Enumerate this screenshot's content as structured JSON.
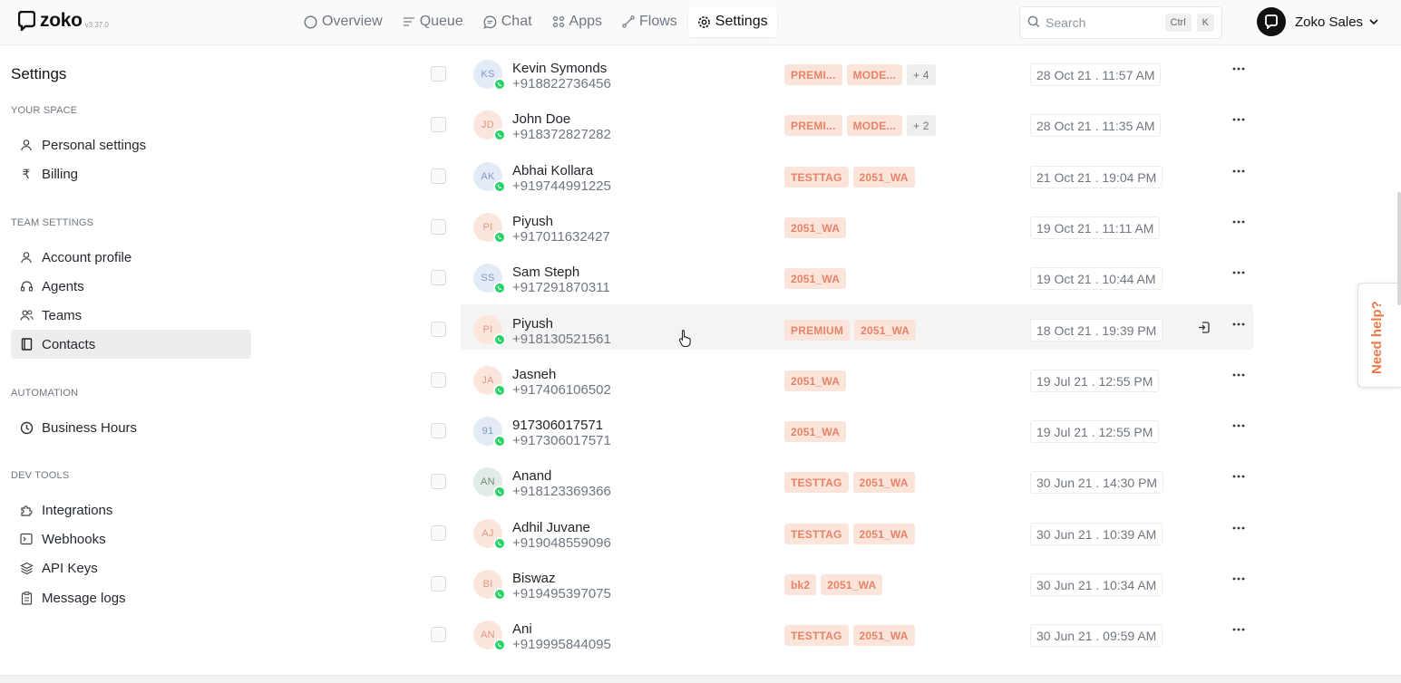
{
  "app": {
    "logo_text": "zoko",
    "version": "v3.37.0"
  },
  "nav": [
    {
      "label": "Overview",
      "icon": "circle-icon",
      "active": false
    },
    {
      "label": "Queue",
      "icon": "list-icon",
      "active": false
    },
    {
      "label": "Chat",
      "icon": "chat-icon",
      "active": false
    },
    {
      "label": "Apps",
      "icon": "grid-icon",
      "active": false
    },
    {
      "label": "Flows",
      "icon": "flow-icon",
      "active": false
    },
    {
      "label": "Settings",
      "icon": "gear-icon",
      "active": true
    }
  ],
  "search": {
    "placeholder": "Search",
    "shortcut_1": "Ctrl",
    "shortcut_2": "K"
  },
  "account": {
    "name": "Zoko Sales"
  },
  "sidebar": {
    "title": "Settings",
    "sections": {
      "your_space": "YOUR SPACE",
      "team_settings": "TEAM SETTINGS",
      "automation": "AUTOMATION",
      "dev_tools": "DEV TOOLS"
    },
    "items": {
      "personal": "Personal settings",
      "billing": "Billing",
      "account_profile": "Account profile",
      "agents": "Agents",
      "teams": "Teams",
      "contacts": "Contacts",
      "business_hours": "Business Hours",
      "integrations": "Integrations",
      "webhooks": "Webhooks",
      "api_keys": "API Keys",
      "message_logs": "Message logs"
    }
  },
  "contacts": [
    {
      "initials": "KS",
      "name": "Kevin Symonds",
      "phone": "+918822736456",
      "tags": [
        "PREMI...",
        "MODE...",
        "+ 4"
      ],
      "date": "28 Oct 21 . 11:57 AM",
      "avatar_color": "blue"
    },
    {
      "initials": "JD",
      "name": "John Doe",
      "phone": "+918372827282",
      "tags": [
        "PREMI...",
        "MODE...",
        "+ 2"
      ],
      "date": "28 Oct 21 . 11:35 AM",
      "avatar_color": "peach"
    },
    {
      "initials": "AK",
      "name": "Abhai Kollara",
      "phone": "+919744991225",
      "tags": [
        "TESTTAG",
        "2051_WA"
      ],
      "date": "21 Oct 21 . 19:04 PM",
      "avatar_color": "blue"
    },
    {
      "initials": "PI",
      "name": "Piyush",
      "phone": "+917011632427",
      "tags": [
        "2051_WA"
      ],
      "date": "19 Oct 21 . 11:11 AM",
      "avatar_color": "peach"
    },
    {
      "initials": "SS",
      "name": "Sam Steph",
      "phone": "+917291870311",
      "tags": [
        "2051_WA"
      ],
      "date": "19 Oct 21 . 10:44 AM",
      "avatar_color": "blue"
    },
    {
      "initials": "PI",
      "name": "Piyush",
      "phone": "+918130521561",
      "tags": [
        "PREMIUM",
        "2051_WA"
      ],
      "date": "18 Oct 21 . 19:39 PM",
      "avatar_color": "peach"
    },
    {
      "initials": "JA",
      "name": "Jasneh",
      "phone": "+917406106502",
      "tags": [
        "2051_WA"
      ],
      "date": "19 Jul 21 . 12:55 PM",
      "avatar_color": "peach"
    },
    {
      "initials": "91",
      "name": "917306017571",
      "phone": "+917306017571",
      "tags": [
        "2051_WA"
      ],
      "date": "19 Jul 21 . 12:55 PM",
      "avatar_color": "blue"
    },
    {
      "initials": "AN",
      "name": "Anand",
      "phone": "+918123369366",
      "tags": [
        "TESTTAG",
        "2051_WA"
      ],
      "date": "30 Jun 21 . 14:30 PM",
      "avatar_color": "green"
    },
    {
      "initials": "AJ",
      "name": "Adhil Juvane",
      "phone": "+919048559096",
      "tags": [
        "TESTTAG",
        "2051_WA"
      ],
      "date": "30 Jun 21 . 10:39 AM",
      "avatar_color": "peach"
    },
    {
      "initials": "BI",
      "name": "Biswaz",
      "phone": "+919495397075",
      "tags": [
        "bk2",
        "2051_WA"
      ],
      "date": "30 Jun 21 . 10:34 AM",
      "avatar_color": "peach"
    },
    {
      "initials": "AN",
      "name": "Ani",
      "phone": "+919995844095",
      "tags": [
        "TESTTAG",
        "2051_WA"
      ],
      "date": "30 Jun 21 . 09:59 AM",
      "avatar_color": "peach"
    }
  ],
  "help": {
    "label": "Need help?"
  },
  "colors": {
    "accent": "#f07a4a",
    "tag_bg": "#fbe4da",
    "tag_text": "#e8836a",
    "whatsapp": "#25d366"
  }
}
